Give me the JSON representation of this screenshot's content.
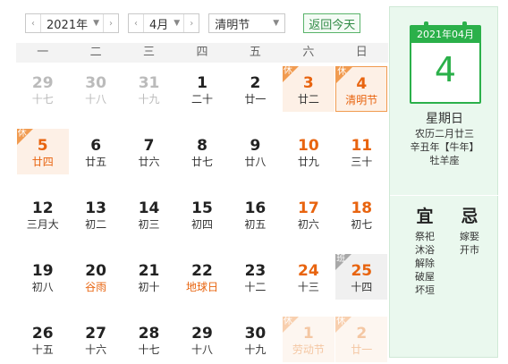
{
  "toolbar": {
    "year": "2021年",
    "month": "4月",
    "holiday": "清明节",
    "today_button": "返回今天"
  },
  "weekdays": [
    "一",
    "二",
    "三",
    "四",
    "五",
    "六",
    "日"
  ],
  "days": [
    {
      "d": "29",
      "l": "十七",
      "type": "grey"
    },
    {
      "d": "30",
      "l": "十八",
      "type": "grey"
    },
    {
      "d": "31",
      "l": "十九",
      "type": "grey"
    },
    {
      "d": "1",
      "l": "二十",
      "type": "normal"
    },
    {
      "d": "2",
      "l": "廿一",
      "type": "normal"
    },
    {
      "d": "3",
      "l": "廿二",
      "type": "rest",
      "tag": "休"
    },
    {
      "d": "4",
      "l": "清明节",
      "type": "rest",
      "tag": "休",
      "festival": true,
      "selected": true
    },
    {
      "d": "5",
      "l": "廿四",
      "type": "rest",
      "tag": "休",
      "festivalNum": true
    },
    {
      "d": "6",
      "l": "廿五",
      "type": "normal"
    },
    {
      "d": "7",
      "l": "廿六",
      "type": "normal"
    },
    {
      "d": "8",
      "l": "廿七",
      "type": "normal"
    },
    {
      "d": "9",
      "l": "廿八",
      "type": "normal"
    },
    {
      "d": "10",
      "l": "廿九",
      "type": "weekend"
    },
    {
      "d": "11",
      "l": "三十",
      "type": "weekend"
    },
    {
      "d": "12",
      "l": "三月大",
      "type": "normal"
    },
    {
      "d": "13",
      "l": "初二",
      "type": "normal"
    },
    {
      "d": "14",
      "l": "初三",
      "type": "normal"
    },
    {
      "d": "15",
      "l": "初四",
      "type": "normal"
    },
    {
      "d": "16",
      "l": "初五",
      "type": "normal"
    },
    {
      "d": "17",
      "l": "初六",
      "type": "weekend"
    },
    {
      "d": "18",
      "l": "初七",
      "type": "weekend"
    },
    {
      "d": "19",
      "l": "初八",
      "type": "normal"
    },
    {
      "d": "20",
      "l": "谷雨",
      "type": "normal",
      "festival": true
    },
    {
      "d": "21",
      "l": "初十",
      "type": "normal"
    },
    {
      "d": "22",
      "l": "地球日",
      "type": "normal",
      "festival": true
    },
    {
      "d": "23",
      "l": "十二",
      "type": "normal"
    },
    {
      "d": "24",
      "l": "十三",
      "type": "weekend"
    },
    {
      "d": "25",
      "l": "十四",
      "type": "work",
      "tag": "班"
    },
    {
      "d": "26",
      "l": "十五",
      "type": "normal"
    },
    {
      "d": "27",
      "l": "十六",
      "type": "normal"
    },
    {
      "d": "28",
      "l": "十七",
      "type": "normal"
    },
    {
      "d": "29",
      "l": "十八",
      "type": "normal"
    },
    {
      "d": "30",
      "l": "十九",
      "type": "normal"
    },
    {
      "d": "1",
      "l": "劳动节",
      "type": "rest-faded",
      "tag": "休"
    },
    {
      "d": "2",
      "l": "廿一",
      "type": "rest-faded",
      "tag": "休"
    }
  ],
  "panel": {
    "header": "2021年04月",
    "day": "4",
    "weekday": "星期日",
    "lunar": "农历二月廿三",
    "ganzhi": "辛丑年【牛年】",
    "zodiac": "牡羊座",
    "yi_title": "宜",
    "ji_title": "忌",
    "yi": [
      "祭祀",
      "沐浴",
      "解除",
      "破屋",
      "坏垣"
    ],
    "ji": [
      "嫁娶",
      "开市"
    ]
  },
  "colors": {
    "accent": "#2bb04a",
    "rest": "#f19b50",
    "weekend": "#e8640f"
  }
}
